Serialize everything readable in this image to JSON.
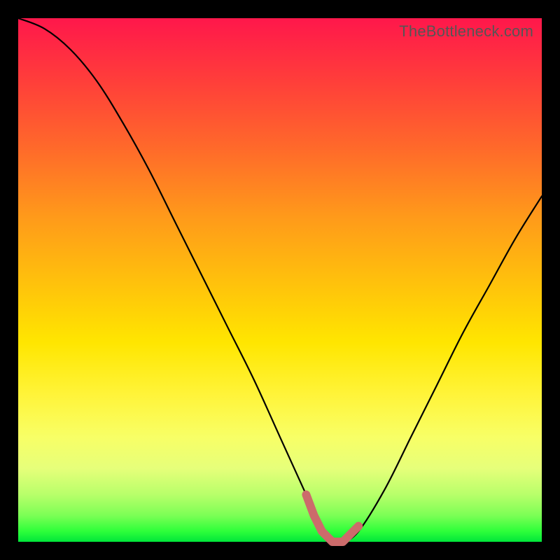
{
  "watermark": "TheBottleneck.com",
  "chart_data": {
    "type": "line",
    "title": "",
    "xlabel": "",
    "ylabel": "",
    "xlim": [
      0,
      100
    ],
    "ylim": [
      0,
      100
    ],
    "series": [
      {
        "name": "bottleneck-curve",
        "x": [
          0,
          5,
          10,
          15,
          20,
          25,
          30,
          35,
          40,
          45,
          50,
          55,
          58,
          60,
          62,
          65,
          70,
          75,
          80,
          85,
          90,
          95,
          100
        ],
        "values": [
          100,
          98,
          94,
          88,
          80,
          71,
          61,
          51,
          41,
          31,
          20,
          9,
          2,
          0,
          0,
          2,
          10,
          20,
          30,
          40,
          49,
          58,
          66
        ]
      }
    ],
    "highlight": {
      "name": "flat-minimum-marker",
      "color": "#cc6b6b",
      "x": [
        55,
        56.5,
        58,
        59,
        60,
        61,
        62,
        63,
        64,
        65
      ],
      "values": [
        9,
        5,
        2,
        1,
        0,
        0,
        0,
        1,
        2,
        3
      ]
    }
  }
}
